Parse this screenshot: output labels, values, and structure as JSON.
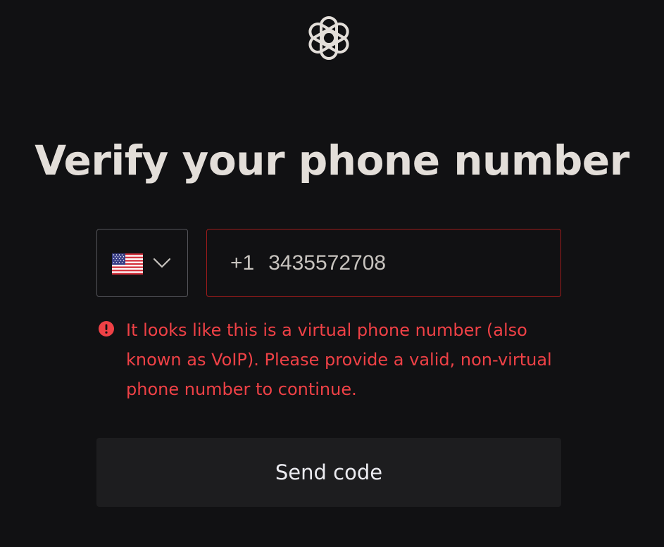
{
  "brand": {
    "logo_icon": "openai-logo-icon",
    "logo_color": "#e3ded9"
  },
  "page": {
    "title": "Verify your phone number"
  },
  "phone": {
    "country": {
      "flag_icon": "us-flag-icon",
      "dropdown_icon": "chevron-down-icon"
    },
    "country_code": "+1",
    "number": "3435572708",
    "border_color": "#9e1b1b"
  },
  "error": {
    "icon": "alert-circle-icon",
    "message": "It looks like this is a virtual phone number (also known as VoIP). Please provide a valid, non-virtual phone number to continue.",
    "color": "#ef4146"
  },
  "actions": {
    "send_code_label": "Send code"
  }
}
